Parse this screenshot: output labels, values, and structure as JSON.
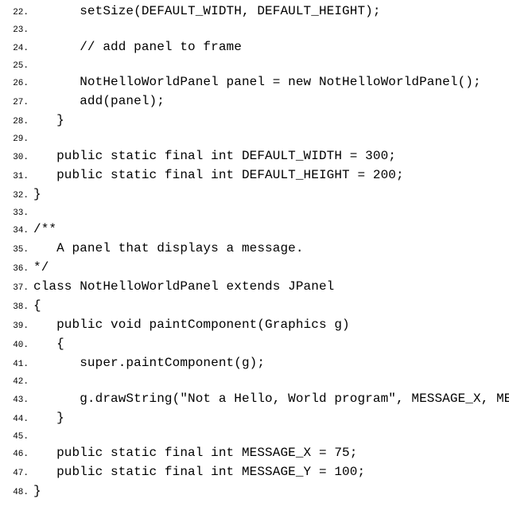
{
  "lines": [
    {
      "n": "22.",
      "code": "      setSize(DEFAULT_WIDTH, DEFAULT_HEIGHT);"
    },
    {
      "n": "23.",
      "code": ""
    },
    {
      "n": "24.",
      "code": "      // add panel to frame"
    },
    {
      "n": "25.",
      "code": ""
    },
    {
      "n": "26.",
      "code": "      NotHelloWorldPanel panel = new NotHelloWorldPanel();"
    },
    {
      "n": "27.",
      "code": "      add(panel);"
    },
    {
      "n": "28.",
      "code": "   }"
    },
    {
      "n": "29.",
      "code": ""
    },
    {
      "n": "30.",
      "code": "   public static final int DEFAULT_WIDTH = 300;"
    },
    {
      "n": "31.",
      "code": "   public static final int DEFAULT_HEIGHT = 200;"
    },
    {
      "n": "32.",
      "code": "}"
    },
    {
      "n": "33.",
      "code": ""
    },
    {
      "n": "34.",
      "code": "/**"
    },
    {
      "n": "35.",
      "code": "   A panel that displays a message."
    },
    {
      "n": "36.",
      "code": "*/"
    },
    {
      "n": "37.",
      "code": "class NotHelloWorldPanel extends JPanel"
    },
    {
      "n": "38.",
      "code": "{"
    },
    {
      "n": "39.",
      "code": "   public void paintComponent(Graphics g)"
    },
    {
      "n": "40.",
      "code": "   {"
    },
    {
      "n": "41.",
      "code": "      super.paintComponent(g);"
    },
    {
      "n": "42.",
      "code": ""
    },
    {
      "n": "43.",
      "code": "      g.drawString(\"Not a Hello, World program\", MESSAGE_X, MESSAGE_Y);"
    },
    {
      "n": "44.",
      "code": "   }"
    },
    {
      "n": "45.",
      "code": ""
    },
    {
      "n": "46.",
      "code": "   public static final int MESSAGE_X = 75;"
    },
    {
      "n": "47.",
      "code": "   public static final int MESSAGE_Y = 100;"
    },
    {
      "n": "48.",
      "code": "}"
    }
  ]
}
